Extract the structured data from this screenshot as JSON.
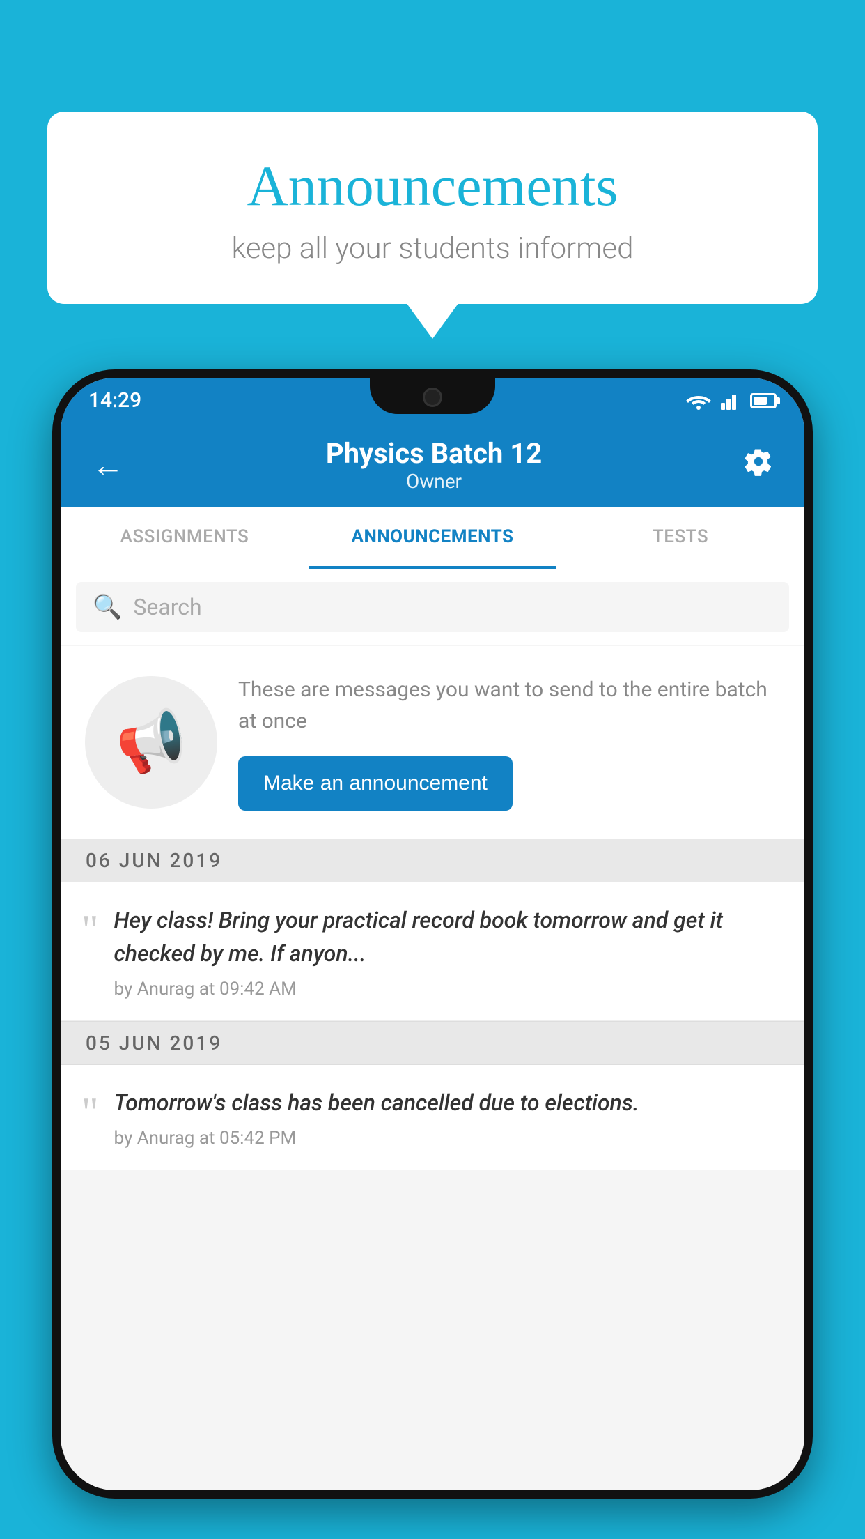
{
  "background": {
    "color": "#1ab3d8"
  },
  "speech_bubble": {
    "title": "Announcements",
    "subtitle": "keep all your students informed"
  },
  "phone": {
    "status_bar": {
      "time": "14:29"
    },
    "app_bar": {
      "title": "Physics Batch 12",
      "subtitle": "Owner",
      "back_label": "←",
      "settings_label": "⚙"
    },
    "tabs": [
      {
        "label": "ASSIGNMENTS",
        "active": false
      },
      {
        "label": "ANNOUNCEMENTS",
        "active": true
      },
      {
        "label": "TESTS",
        "active": false
      }
    ],
    "search": {
      "placeholder": "Search"
    },
    "promo": {
      "description": "These are messages you want to send to the entire batch at once",
      "button_label": "Make an announcement"
    },
    "announcements": [
      {
        "date": "06  JUN  2019",
        "message": "Hey class! Bring your practical record book tomorrow and get it checked by me. If anyon...",
        "meta": "by Anurag at 09:42 AM"
      },
      {
        "date": "05  JUN  2019",
        "message": "Tomorrow's class has been cancelled due to elections.",
        "meta": "by Anurag at 05:42 PM"
      }
    ]
  }
}
